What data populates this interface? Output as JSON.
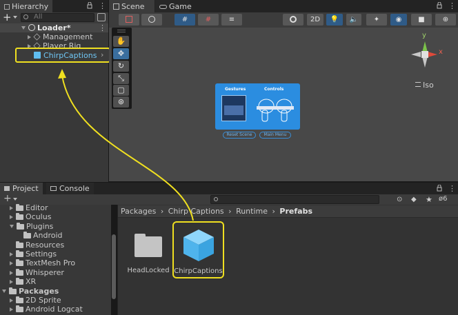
{
  "hierarchy": {
    "tab_label": "Hierarchy",
    "search_placeholder": "All",
    "add_label": "+",
    "items": [
      {
        "label": "Loader*"
      },
      {
        "label": "Management"
      },
      {
        "label": "Player Rig"
      },
      {
        "label": "ChirpCaptions"
      }
    ]
  },
  "scene": {
    "tab_scene": "Scene",
    "tab_game": "Game",
    "btn_2d": "2D",
    "iso_label": "Iso",
    "gizmo_y": "y",
    "gizmo_x": "x",
    "preview": {
      "gestures": "Gestures",
      "controls": "Controls",
      "reset": "Reset Scene",
      "menu": "Main Menu"
    }
  },
  "project": {
    "tab_project": "Project",
    "tab_console": "Console",
    "add_label": "+",
    "hidden_count": "6",
    "tree": [
      {
        "label": "Editor",
        "indent": 1,
        "expanded": false
      },
      {
        "label": "Oculus",
        "indent": 1,
        "expanded": false
      },
      {
        "label": "Plugins",
        "indent": 1,
        "expanded": true
      },
      {
        "label": "Android",
        "indent": 2,
        "expanded": null
      },
      {
        "label": "Resources",
        "indent": 1,
        "expanded": null
      },
      {
        "label": "Settings",
        "indent": 1,
        "expanded": false
      },
      {
        "label": "TextMesh Pro",
        "indent": 1,
        "expanded": false
      },
      {
        "label": "Whisperer",
        "indent": 1,
        "expanded": false
      },
      {
        "label": "XR",
        "indent": 1,
        "expanded": false
      },
      {
        "label": "Packages",
        "indent": 0,
        "expanded": true
      },
      {
        "label": "2D Sprite",
        "indent": 1,
        "expanded": false
      },
      {
        "label": "Android Logcat",
        "indent": 1,
        "expanded": false
      }
    ],
    "breadcrumb": [
      "Packages",
      "Chirp Captions",
      "Runtime",
      "Prefabs"
    ],
    "assets": [
      {
        "label": "HeadLocked"
      },
      {
        "label": "ChirpCaptions"
      }
    ]
  },
  "colors": {
    "highlight": "#f0e020",
    "accent": "#3a8fd9",
    "prefab": "#5fbdf0"
  }
}
